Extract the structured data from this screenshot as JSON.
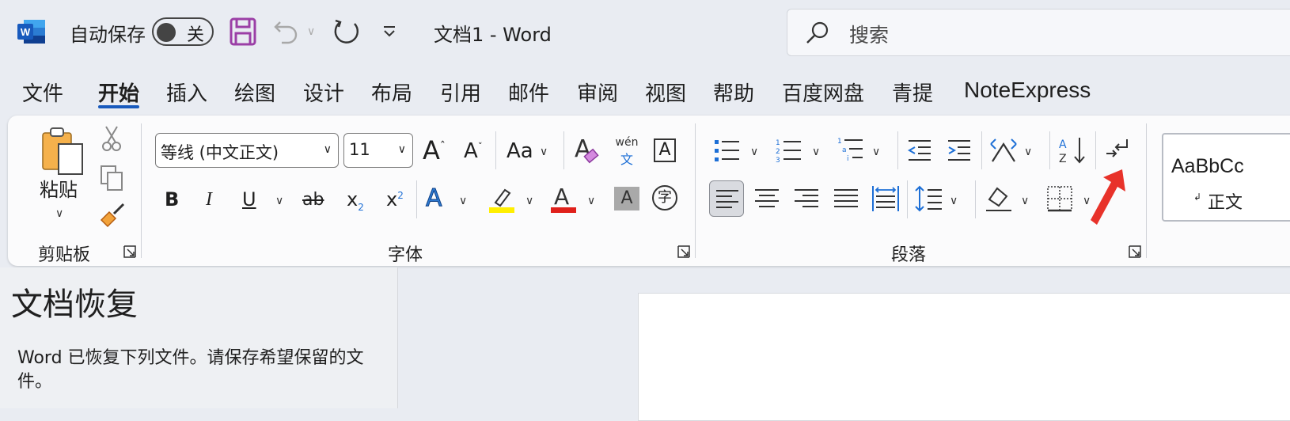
{
  "titlebar": {
    "autosave_label": "自动保存",
    "autosave_state": "关",
    "doc_title": "文档1  -  Word",
    "search_placeholder": "搜索"
  },
  "tabs": [
    {
      "label": "文件"
    },
    {
      "label": "开始"
    },
    {
      "label": "插入"
    },
    {
      "label": "绘图"
    },
    {
      "label": "设计"
    },
    {
      "label": "布局"
    },
    {
      "label": "引用"
    },
    {
      "label": "邮件"
    },
    {
      "label": "审阅"
    },
    {
      "label": "视图"
    },
    {
      "label": "帮助"
    },
    {
      "label": "百度网盘"
    },
    {
      "label": "青提"
    },
    {
      "label": "NoteExpress"
    }
  ],
  "active_tab": "开始",
  "ribbon": {
    "clipboard": {
      "paste_label": "粘贴",
      "group_label": "剪贴板"
    },
    "font": {
      "font_name": "等线 (中文正文)",
      "font_size": "11",
      "phonetic_top": "wén",
      "phonetic_bottom": "文",
      "border_char": "A",
      "enclose_char": "字",
      "case_label": "Aa",
      "group_label": "字体"
    },
    "paragraph": {
      "group_label": "段落"
    },
    "styles": {
      "preview_text": "AaBbCc",
      "style_name": "正文"
    }
  },
  "recovery": {
    "title": "文档恢复",
    "message": "Word 已恢复下列文件。请保存希望保留的文件。"
  },
  "colors": {
    "accent": "#185abd",
    "highlight": "#ffef00",
    "font_color": "#e0201b",
    "arrow_annotation": "#e8322a",
    "save_icon": "#9b3fa6"
  }
}
